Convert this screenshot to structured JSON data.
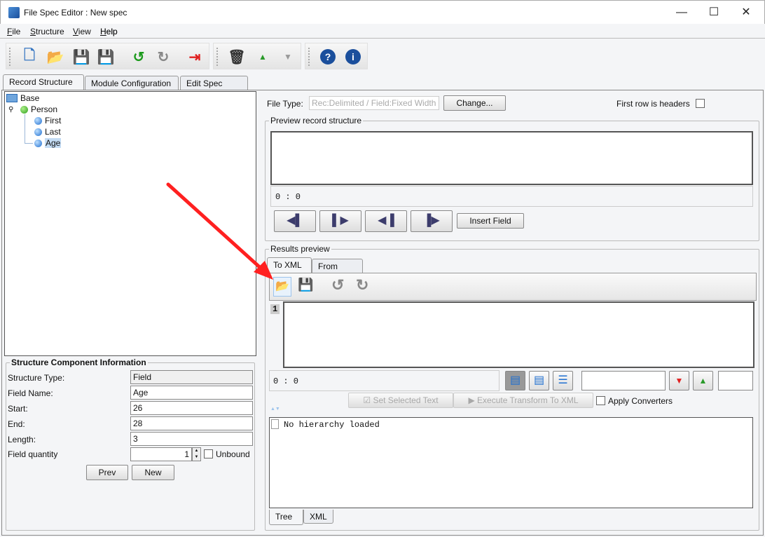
{
  "window": {
    "title": "File Spec Editor : New spec",
    "minimize": "—",
    "maximize": "☐",
    "close": "✕"
  },
  "menu": [
    {
      "label": "File",
      "key": "F",
      "rest": "ile"
    },
    {
      "label": "Structure",
      "key": "S",
      "rest": "tructure"
    },
    {
      "label": "View",
      "key": "V",
      "rest": "iew"
    },
    {
      "label": "Help",
      "key": "H",
      "rest": "elp"
    }
  ],
  "toolbar": {
    "icons": [
      "new-file-icon",
      "open-folder-icon",
      "save-icon",
      "save-as-icon",
      "undo-icon",
      "redo-icon",
      "exit-icon",
      "delete-icon",
      "move-up-icon",
      "move-down-icon",
      "help-icon",
      "info-icon"
    ]
  },
  "tabs": [
    "Record Structure",
    "Module Configuration",
    "Edit Spec XML"
  ],
  "tree": {
    "root": "Base",
    "record": "Person",
    "fields": [
      "First",
      "Last",
      "Age"
    ],
    "selected": "Age"
  },
  "info": {
    "legend": "Structure Component Information",
    "rows": [
      {
        "label": "Structure Type:",
        "value": "Field"
      },
      {
        "label": "Field Name:",
        "value": "Age"
      },
      {
        "label": "Start:",
        "value": "26"
      },
      {
        "label": "End:",
        "value": "28"
      },
      {
        "label": "Length:",
        "value": "3"
      }
    ],
    "quantity_label": "Field quantity",
    "quantity": "1",
    "unbound": "Unbound",
    "prev": "Prev",
    "new": "New"
  },
  "right": {
    "file_type_label": "File Type:",
    "file_type_value": "Rec:Delimited / Field:Fixed Width",
    "change": "Change...",
    "first_row": "First row is headers",
    "preview_legend": "Preview record structure",
    "preview_pos": "0 : 0",
    "insert_field": "Insert Field",
    "results_legend": "Results preview",
    "result_tabs": [
      "To XML",
      "From XML"
    ],
    "line_number": "1",
    "editor_pos": "0 : 0",
    "set_selected": "Set Selected Text",
    "execute": "Execute Transform To XML",
    "apply_converters": "Apply Converters",
    "no_hierarchy": "No hierarchy loaded",
    "bottom_tabs": [
      "Tree",
      "XML"
    ]
  },
  "annotation": {
    "arrow_color": "#ff2020"
  }
}
